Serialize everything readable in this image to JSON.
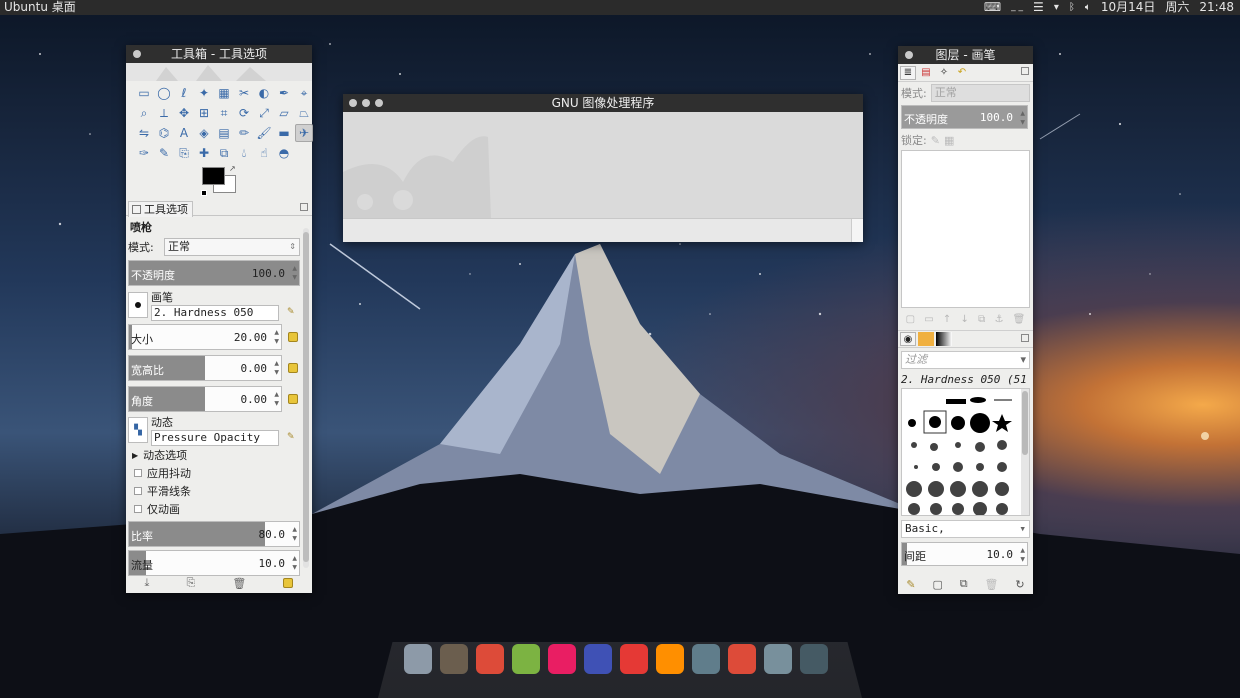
{
  "top_panel": {
    "title": "Ubuntu 桌面",
    "date": "10月14日",
    "weekday": "周六",
    "time": "21:48",
    "indicators": [
      "keyboard-icon",
      "input-method-icon",
      "menu-icon",
      "wifi-icon",
      "bluetooth-icon",
      "volume-icon"
    ]
  },
  "toolbox": {
    "title": "工具箱 - 工具选项",
    "tools": [
      "rect-select",
      "ellipse-select",
      "lasso",
      "fuzzy-select",
      "select-by-color",
      "scissors",
      "foreground-select",
      "paths",
      "color-picker",
      "zoom",
      "measure",
      "move",
      "align",
      "crop",
      "rotate",
      "scale",
      "shear",
      "perspective",
      "flip",
      "cage",
      "text",
      "bucket-fill",
      "blend",
      "pencil",
      "paintbrush",
      "eraser",
      "airbrush",
      "ink",
      "mypaint",
      "clone",
      "heal",
      "perspective-clone",
      "blur",
      "smudge",
      "dodge-burn"
    ],
    "selected_tool": "airbrush",
    "colors": {
      "foreground": "#000000",
      "background": "#ffffff"
    },
    "tab_label": "工具选项",
    "tool_name": "喷枪",
    "mode_label": "模式:",
    "mode_value": "正常",
    "opacity_label": "不透明度",
    "opacity_value": "100.0",
    "opacity_fraction": 1.0,
    "brush_label": "画笔",
    "brush_value": "2. Hardness 050",
    "size_label": "大小",
    "size_value": "20.00",
    "size_fraction": 0.02,
    "aspect_label": "宽高比",
    "aspect_value": "0.00",
    "aspect_fraction": 0.5,
    "angle_label": "角度",
    "angle_value": "0.00",
    "angle_fraction": 0.5,
    "dynamics_label": "动态",
    "dynamics_value": "Pressure Opacity",
    "dynamics_options_label": "动态选项",
    "apply_jitter_label": "应用抖动",
    "smooth_stroke_label": "平滑线条",
    "incremental_label": "仅动画",
    "rate_label": "比率",
    "rate_value": "80.0",
    "rate_fraction": 0.8,
    "flow_label": "流量",
    "flow_value": "10.0",
    "flow_fraction": 0.1
  },
  "main_window": {
    "title": "GNU 图像处理程序"
  },
  "layers_panel": {
    "title": "图层 - 画笔",
    "mode_label": "模式:",
    "mode_value": "正常",
    "opacity_label": "不透明度",
    "opacity_value": "100.0",
    "lock_label": "锁定:",
    "filter_placeholder": "过滤",
    "brush_name": "2. Hardness 050 (51",
    "brush_set": "Basic,",
    "spacing_label": "间距",
    "spacing_value": "10.0"
  },
  "dock": {
    "apps": [
      {
        "name": "files-icon",
        "color": "#8d9aa8"
      },
      {
        "name": "gimp-icon",
        "color": "#6b5e4e"
      },
      {
        "name": "chrome-icon",
        "color": "#dd4b39"
      },
      {
        "name": "android-studio-icon",
        "color": "#7cb342"
      },
      {
        "name": "flickr-icon",
        "color": "#e91e63"
      },
      {
        "name": "aperture-icon",
        "color": "#3f51b5"
      },
      {
        "name": "netease-music-icon",
        "color": "#e53935"
      },
      {
        "name": "vlc-icon",
        "color": "#ff8f00"
      },
      {
        "name": "settings-toggle-icon",
        "color": "#607d8b"
      },
      {
        "name": "chrome-icon-2",
        "color": "#dd4b39"
      },
      {
        "name": "system-settings-icon",
        "color": "#78909c"
      },
      {
        "name": "terminal-icon",
        "color": "#455a64"
      }
    ]
  }
}
